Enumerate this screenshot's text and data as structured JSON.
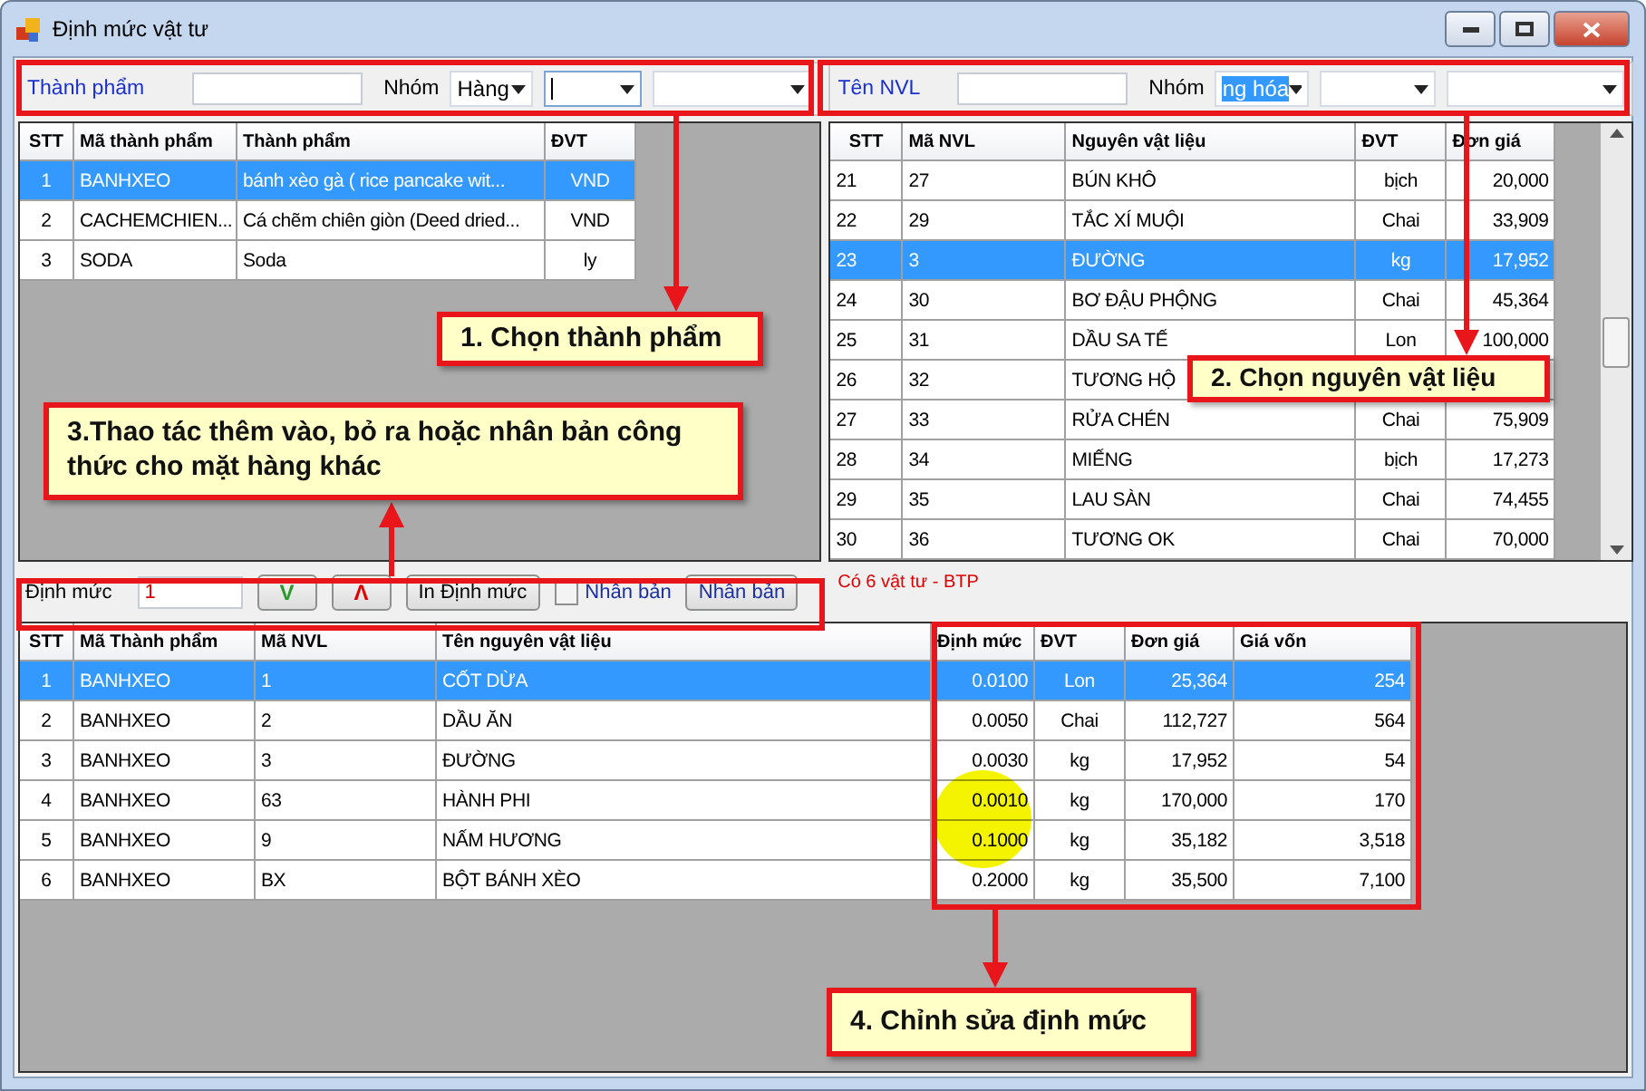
{
  "window": {
    "title": "Định mức vật tư"
  },
  "left_filter": {
    "label": "Thành phẩm",
    "group_label": "Nhóm",
    "group_value": "Hàng"
  },
  "left_table": {
    "columns": [
      "STT",
      "Mã thành phẩm",
      "Thành phẩm",
      "ĐVT"
    ],
    "rows": [
      {
        "cells": [
          "1",
          "BANHXEO",
          "bánh xèo gà ( rice pancake wit...",
          "VND"
        ],
        "selected": true
      },
      {
        "cells": [
          "2",
          "CACHEMCHIEN...",
          "Cá chẽm chiên giòn (Deed dried...",
          "VND"
        ],
        "selected": false
      },
      {
        "cells": [
          "3",
          "SODA",
          "Soda",
          "ly"
        ],
        "selected": false
      }
    ]
  },
  "right_filter": {
    "label": "Tên NVL",
    "group_label": "Nhóm",
    "group_value": "ng hóa"
  },
  "right_table": {
    "columns": [
      "STT",
      "Mã NVL",
      "Nguyên vật liệu",
      "ĐVT",
      "Đơn giá"
    ],
    "rows": [
      {
        "cells": [
          "21",
          "27",
          "BÚN KHÔ",
          "bịch",
          "20,000"
        ],
        "selected": false
      },
      {
        "cells": [
          "22",
          "29",
          "TẮC XÍ MUỘI",
          "Chai",
          "33,909"
        ],
        "selected": false
      },
      {
        "cells": [
          "23",
          "3",
          "ĐƯỜNG",
          "kg",
          "17,952"
        ],
        "selected": true
      },
      {
        "cells": [
          "24",
          "30",
          "BƠ ĐẬU PHỘNG",
          "Chai",
          "45,364"
        ],
        "selected": false
      },
      {
        "cells": [
          "25",
          "31",
          "DẦU SA TẾ",
          "Lon",
          "100,000"
        ],
        "selected": false
      },
      {
        "cells": [
          "26",
          "32",
          "TƯƠNG HỘ",
          "",
          ""
        ],
        "selected": false
      },
      {
        "cells": [
          "27",
          "33",
          "RỬA CHÉN",
          "Chai",
          "75,909"
        ],
        "selected": false
      },
      {
        "cells": [
          "28",
          "34",
          "MIẾNG",
          "bịch",
          "17,273"
        ],
        "selected": false
      },
      {
        "cells": [
          "29",
          "35",
          "LAU SÀN",
          "Chai",
          "74,455"
        ],
        "selected": false
      },
      {
        "cells": [
          "30",
          "36",
          "TƯƠNG OK",
          "Chai",
          "70,000"
        ],
        "selected": false
      }
    ]
  },
  "toolbar": {
    "label": "Định mức",
    "value": "1",
    "down_button": "V",
    "up_button": "Λ",
    "print_button": "In Định mức",
    "copy_checkbox": {
      "label": "Nhân bản",
      "checked": false
    },
    "copy_button": "Nhân bản",
    "status": "Có 6 vật tư - BTP"
  },
  "bottom_table": {
    "columns": [
      "STT",
      "Mã Thành phẩm",
      "Mã NVL",
      "Tên nguyên vật liệu",
      "Định mức",
      "ĐVT",
      "Đơn giá",
      "Giá vốn"
    ],
    "rows": [
      {
        "cells": [
          "1",
          "BANHXEO",
          "1",
          "CỐT DỪA",
          "0.0100",
          "Lon",
          "25,364",
          "254"
        ],
        "selected": true
      },
      {
        "cells": [
          "2",
          "BANHXEO",
          "2",
          "DẦU ĂN",
          "0.0050",
          "Chai",
          "112,727",
          "564"
        ],
        "selected": false
      },
      {
        "cells": [
          "3",
          "BANHXEO",
          "3",
          "ĐƯỜNG",
          "0.0030",
          "kg",
          "17,952",
          "54"
        ],
        "selected": false
      },
      {
        "cells": [
          "4",
          "BANHXEO",
          "63",
          "HÀNH PHI",
          "0.0010",
          "kg",
          "170,000",
          "170"
        ],
        "selected": false
      },
      {
        "cells": [
          "5",
          "BANHXEO",
          "9",
          "NẤM HƯƠNG",
          "0.1000",
          "kg",
          "35,182",
          "3,518"
        ],
        "selected": false
      },
      {
        "cells": [
          "6",
          "BANHXEO",
          "BX",
          "BỘT BÁNH XÈO",
          "0.2000",
          "kg",
          "35,500",
          "7,100"
        ],
        "selected": false
      }
    ]
  },
  "callouts": [
    {
      "text": "1. Chọn thành phẩm"
    },
    {
      "text": "2. Chọn nguyên vật liệu"
    },
    {
      "text": "3.Thao tác thêm vào, bỏ ra hoặc nhân bản công thức cho mặt hàng khác"
    },
    {
      "text": "4. Chỉnh sửa định mức"
    }
  ]
}
